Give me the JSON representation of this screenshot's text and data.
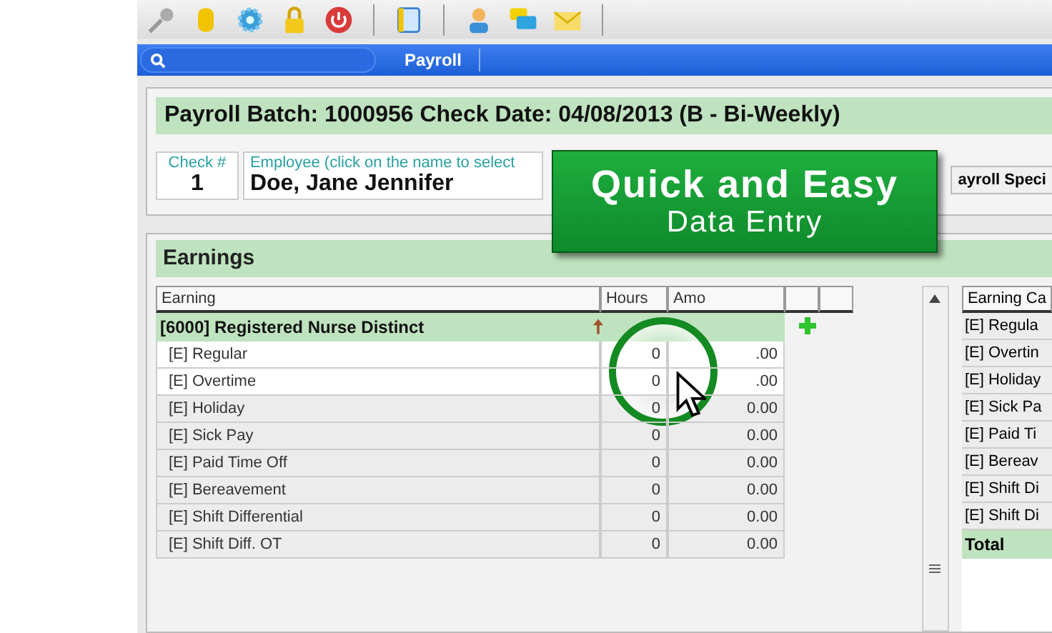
{
  "nav": {
    "tab": "Payroll"
  },
  "batch_title": "Payroll Batch: 1000956 Check Date: 04/08/2013 (B - Bi-Weekly)",
  "check": {
    "label": "Check #",
    "value": "1"
  },
  "employee": {
    "label": "Employee (click on the name to select",
    "value": "Doe, Jane Jennifer"
  },
  "payroll_special_button": "ayroll Speci",
  "banner": {
    "title": "Quick and Easy",
    "subtitle": "Data Entry"
  },
  "earnings": {
    "title": "Earnings",
    "columns": [
      "Earning",
      "Hours",
      "Amo"
    ],
    "group": "[6000] Registered Nurse Distinct",
    "rows": [
      {
        "name": "[E] Regular",
        "hours": "0",
        "amount": ".00",
        "highlighted": true
      },
      {
        "name": "[E] Overtime",
        "hours": "0",
        "amount": ".00",
        "highlighted": true
      },
      {
        "name": "[E] Holiday",
        "hours": "0",
        "amount": "0.00",
        "highlighted": false
      },
      {
        "name": "[E] Sick Pay",
        "hours": "0",
        "amount": "0.00",
        "highlighted": false
      },
      {
        "name": "[E] Paid Time Off",
        "hours": "0",
        "amount": "0.00",
        "highlighted": false
      },
      {
        "name": "[E] Bereavement",
        "hours": "0",
        "amount": "0.00",
        "highlighted": false
      },
      {
        "name": "[E] Shift Differential",
        "hours": "0",
        "amount": "0.00",
        "highlighted": false
      },
      {
        "name": "[E] Shift Diff. OT",
        "hours": "0",
        "amount": "0.00",
        "highlighted": false
      }
    ]
  },
  "side_panel": {
    "column": "Earning Ca",
    "rows": [
      "[E] Regula",
      "[E] Overtin",
      "[E] Holiday",
      "[E] Sick Pa",
      "[E] Paid Ti",
      "[E] Bereav",
      "[E] Shift Di",
      "[E] Shift Di"
    ],
    "total": "Total"
  }
}
